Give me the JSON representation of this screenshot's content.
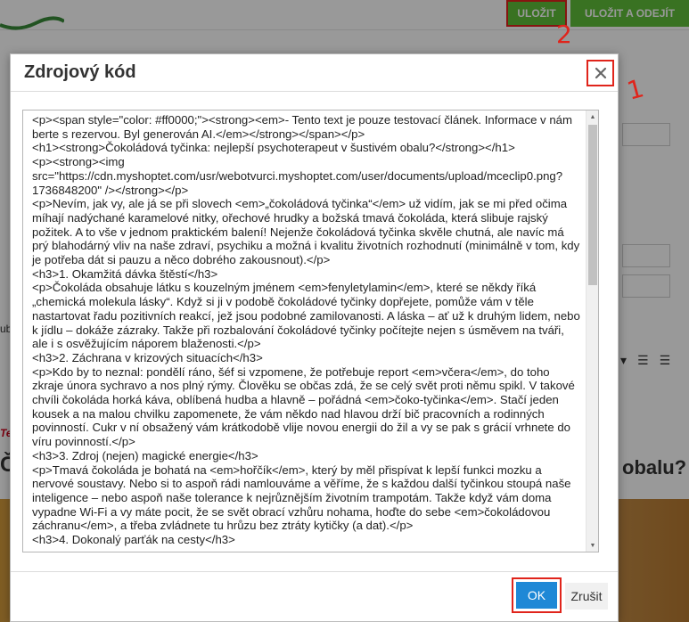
{
  "topbar": {
    "save_label": "ULOŽIT",
    "save_exit_label": "ULOŽIT A ODEJÍT"
  },
  "background": {
    "heading_right": "obalu?",
    "heading_left": "Č",
    "red_fragment": "Te",
    "side_fragment": "ub"
  },
  "annotations": {
    "mark_1": "1",
    "mark_2": "2"
  },
  "modal": {
    "title": "Zdrojový kód",
    "code": "<p><span style=\"color: #ff0000;\"><strong><em>- Tento text je pouze testovací článek. Informace v nám berte s rezervou. Byl generován AI.</em></strong></span></p>\n<h1><strong>Čokoládová tyčinka: nejlepší psychoterapeut v šustivém obalu?</strong></h1>\n<p><strong><img src=\"https://cdn.myshoptet.com/usr/webotvurci.myshoptet.com/user/documents/upload/mceclip0.png?1736848200\" /></strong></p>\n<p>Nevím, jak vy, ale já se při slovech <em>„čokoládová tyčinka“</em> už vidím, jak se mi před očima míhají nadýchané karamelové nitky, ořechové hrudky a božská tmavá čokoláda, která slibuje rajský požitek. A to vše v jednom praktickém balení! Nejenže čokoládová tyčinka skvěle chutná, ale navíc má prý blahodárný vliv na naše zdraví, psychiku a možná i kvalitu životních rozhodnutí (minimálně v tom, kdy je potřeba dát si pauzu a něco dobrého zakousnout).</p>\n<h3>1. Okamžitá dávka štěstí</h3>\n<p>Čokoláda obsahuje látku s kouzelným jménem <em>fenyletylamin</em>, které se někdy říká „chemická molekula lásky“. Když si ji v podobě čokoládové tyčinky dopřejete, pomůže vám v těle nastartovat řadu pozitivních reakcí, jež jsou podobné zamilovanosti. A láska – ať už k druhým lidem, nebo k jídlu – dokáže zázraky. Takže při rozbalování čokoládové tyčinky počítejte nejen s úsměvem na tváři, ale i s osvěžujícím náporem blaženosti.</p>\n<h3>2. Záchrana v krizových situacích</h3>\n<p>Kdo by to neznal: pondělí ráno, šéf si vzpomene, že potřebuje report <em>včera</em>, do toho zkraje února sychravo a nos plný rýmy. Člověku se občas zdá, že se celý svět proti němu spikl. V takové chvíli čokoláda horká káva, oblíbená hudba a hlavně – pořádná <em>čoko-tyčinka</em>. Stačí jeden kousek a na malou chvilku zapomenete, že vám někdo nad hlavou drží bič pracovních a rodinných povinností. Cukr v ní obsažený vám krátkodobě vlije novou energii do žil a vy se pak s grácií vrhnete do víru povinností.</p>\n<h3>3. Zdroj (nejen) magické energie</h3>\n<p>Tmavá čokoláda je bohatá na <em>hořčík</em>, který by měl přispívat k lepší funkci mozku a nervové soustavy. Nebo si to aspoň rádi namlouváme a věříme, že s každou další tyčinkou stoupá naše inteligence – nebo aspoň naše tolerance k nejrůznějším životním trampotám. Takže když vám doma vypadne Wi-Fi a vy máte pocit, že se svět obrací vzhůru nohama, hoďte do sebe <em>čokoládovou záchranu</em>, a třeba zvládnete tu hrůzu bez ztráty kytičky (a dat).</p>\n<h3>4. Dokonalý parťák na cesty</h3>",
    "ok_label": "OK",
    "cancel_label": "Zrušit"
  }
}
